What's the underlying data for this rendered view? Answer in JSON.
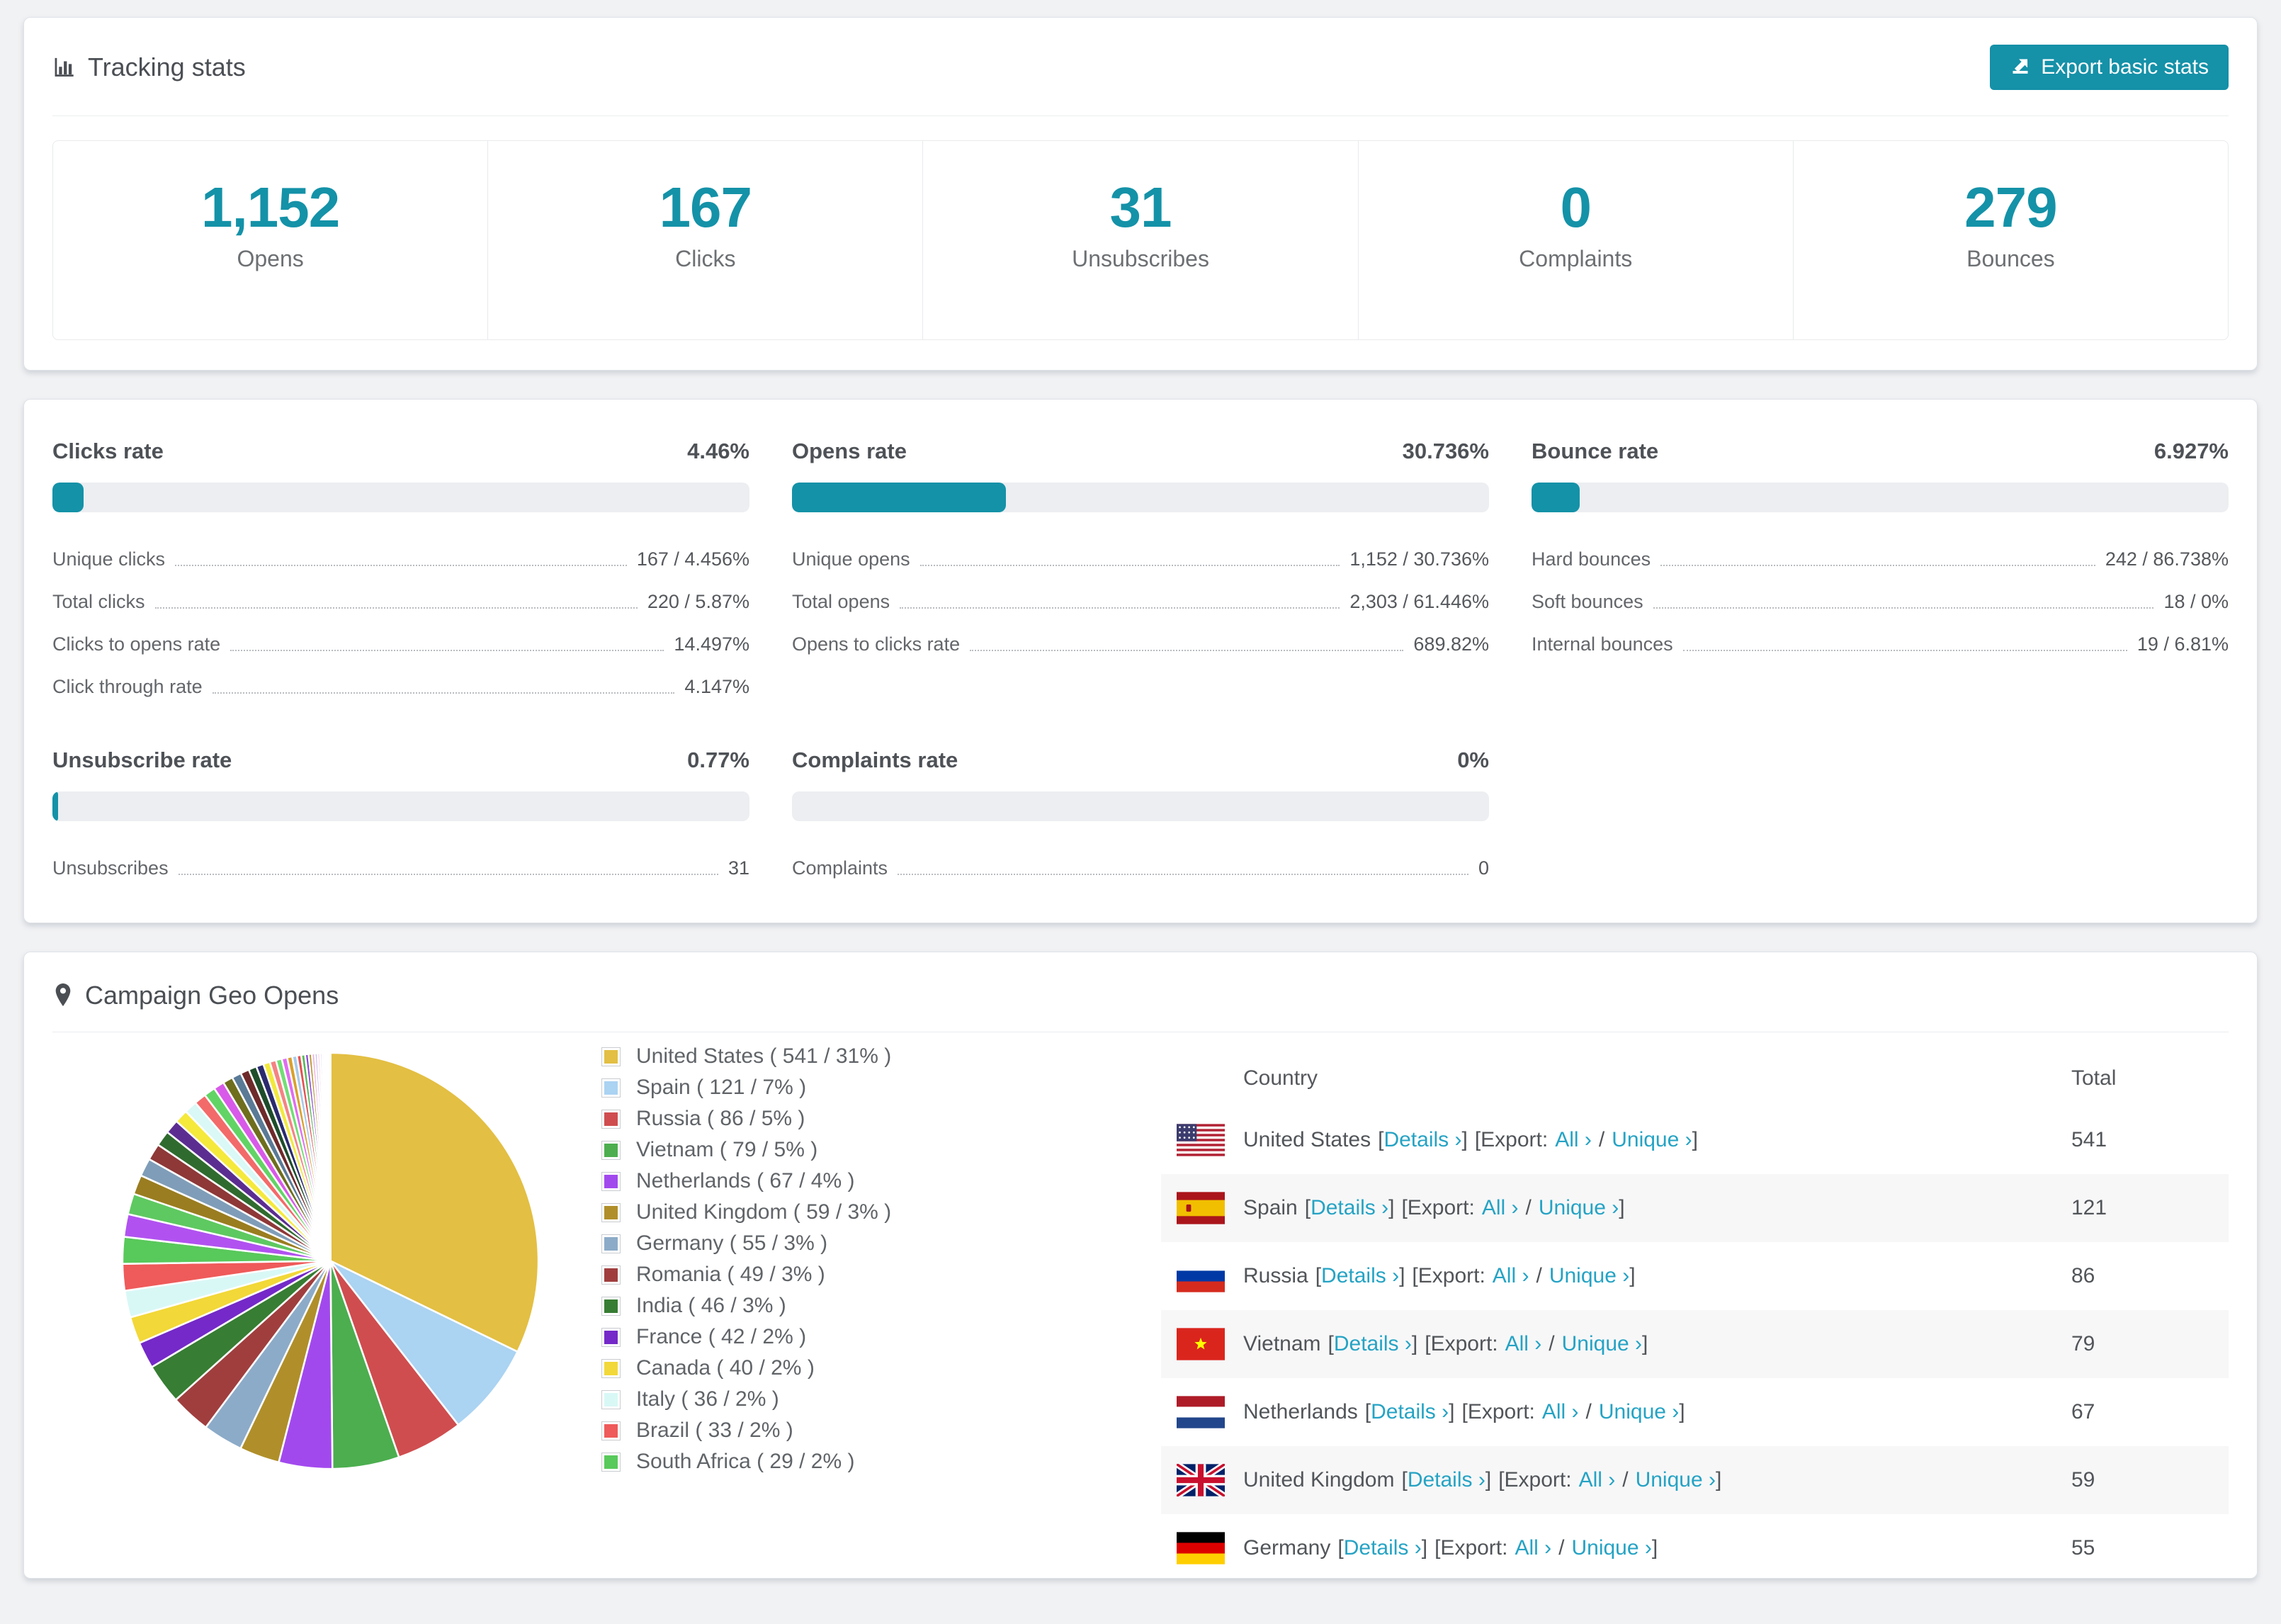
{
  "colors": {
    "accent": "#1492a8",
    "link": "#25a3c4",
    "bar_track": "#eceef1"
  },
  "tracking": {
    "title": "Tracking stats",
    "export_button": "Export basic stats",
    "stats": [
      {
        "value": "1,152",
        "label": "Opens"
      },
      {
        "value": "167",
        "label": "Clicks"
      },
      {
        "value": "31",
        "label": "Unsubscribes"
      },
      {
        "value": "0",
        "label": "Complaints"
      },
      {
        "value": "279",
        "label": "Bounces"
      }
    ]
  },
  "rates": {
    "panels": [
      {
        "title": "Clicks rate",
        "value": "4.46%",
        "pct": 4.46,
        "rows": [
          [
            "Unique clicks",
            "167 / 4.456%"
          ],
          [
            "Total clicks",
            "220 / 5.87%"
          ],
          [
            "Clicks to opens rate",
            "14.497%"
          ],
          [
            "Click through rate",
            "4.147%"
          ]
        ]
      },
      {
        "title": "Opens rate",
        "value": "30.736%",
        "pct": 30.736,
        "rows": [
          [
            "Unique opens",
            "1,152 / 30.736%"
          ],
          [
            "Total opens",
            "2,303 / 61.446%"
          ],
          [
            "Opens to clicks rate",
            "689.82%"
          ]
        ]
      },
      {
        "title": "Bounce rate",
        "value": "6.927%",
        "pct": 6.927,
        "rows": [
          [
            "Hard bounces",
            "242 / 86.738%"
          ],
          [
            "Soft bounces",
            "18 / 0%"
          ],
          [
            "Internal bounces",
            "19 / 6.81%"
          ]
        ]
      },
      {
        "title": "Unsubscribe rate",
        "value": "0.77%",
        "pct": 0.77,
        "rows": [
          [
            "Unsubscribes",
            "31"
          ]
        ]
      },
      {
        "title": "Complaints rate",
        "value": "0%",
        "pct": 0,
        "rows": [
          [
            "Complaints",
            "0"
          ]
        ]
      }
    ]
  },
  "geo": {
    "title": "Campaign Geo Opens",
    "legend": [
      {
        "label": "United States ( 541 / 31% )",
        "color": "#e3bf43"
      },
      {
        "label": "Spain ( 121 / 7% )",
        "color": "#abd3f2"
      },
      {
        "label": "Russia ( 86 / 5% )",
        "color": "#cf4d4f"
      },
      {
        "label": "Vietnam ( 79 / 5% )",
        "color": "#4cae4f"
      },
      {
        "label": "Netherlands ( 67 / 4% )",
        "color": "#a249ee"
      },
      {
        "label": "United Kingdom ( 59 / 3% )",
        "color": "#b08f2a"
      },
      {
        "label": "Germany ( 55 / 3% )",
        "color": "#8cabc8"
      },
      {
        "label": "Romania ( 49 / 3% )",
        "color": "#a03e3e"
      },
      {
        "label": "India ( 46 / 3% )",
        "color": "#377d33"
      },
      {
        "label": "France ( 42 / 2% )",
        "color": "#7429c8"
      },
      {
        "label": "Canada ( 40 / 2% )",
        "color": "#f2d838"
      },
      {
        "label": "Italy ( 36 / 2% )",
        "color": "#d8f8f6"
      },
      {
        "label": "Brazil ( 33 / 2% )",
        "color": "#ef5a5a"
      },
      {
        "label": "South Africa ( 29 / 2% )",
        "color": "#58c95b"
      }
    ],
    "table": {
      "country_header": "Country",
      "total_header": "Total",
      "syntax": {
        "open": "[",
        "close": "]",
        "export_open": "[Export:",
        "slash": "/"
      },
      "links": {
        "details": "Details ›",
        "all": "All ›",
        "unique": "Unique ›"
      },
      "rows": [
        {
          "flag": "us",
          "country": "United States",
          "total": "541"
        },
        {
          "flag": "es",
          "country": "Spain",
          "total": "121"
        },
        {
          "flag": "ru",
          "country": "Russia",
          "total": "86"
        },
        {
          "flag": "vn",
          "country": "Vietnam",
          "total": "79"
        },
        {
          "flag": "nl",
          "country": "Netherlands",
          "total": "67"
        },
        {
          "flag": "gb",
          "country": "United Kingdom",
          "total": "59"
        },
        {
          "flag": "de",
          "country": "Germany",
          "total": "55"
        }
      ]
    }
  },
  "chart_data": {
    "type": "pie",
    "title": "Campaign Geo Opens",
    "legend_position": "right",
    "start_angle_deg": -90,
    "direction": "clockwise",
    "slices": [
      {
        "name": "United States",
        "value": 541,
        "pct": 31,
        "color": "#e3bf43"
      },
      {
        "name": "Spain",
        "value": 121,
        "pct": 7,
        "color": "#abd3f2"
      },
      {
        "name": "Russia",
        "value": 86,
        "pct": 5,
        "color": "#cf4d4f"
      },
      {
        "name": "Vietnam",
        "value": 79,
        "pct": 5,
        "color": "#4cae4f"
      },
      {
        "name": "Netherlands",
        "value": 67,
        "pct": 4,
        "color": "#a249ee"
      },
      {
        "name": "United Kingdom",
        "value": 59,
        "pct": 3,
        "color": "#b08f2a"
      },
      {
        "name": "Germany",
        "value": 55,
        "pct": 3,
        "color": "#8cabc8"
      },
      {
        "name": "Romania",
        "value": 49,
        "pct": 3,
        "color": "#a03e3e"
      },
      {
        "name": "India",
        "value": 46,
        "pct": 3,
        "color": "#377d33"
      },
      {
        "name": "France",
        "value": 42,
        "pct": 2,
        "color": "#7429c8"
      },
      {
        "name": "Canada",
        "value": 40,
        "pct": 2,
        "color": "#f2d838"
      },
      {
        "name": "Italy",
        "value": 36,
        "pct": 2,
        "color": "#d8f8f6"
      },
      {
        "name": "Brazil",
        "value": 33,
        "pct": 2,
        "color": "#ef5a5a"
      },
      {
        "name": "South Africa",
        "value": 29,
        "pct": 2,
        "color": "#58c95b"
      }
    ],
    "other_slices": [
      {
        "pct": 1.7,
        "color": "#b152f0"
      },
      {
        "pct": 1.55,
        "color": "#5ec960"
      },
      {
        "pct": 1.45,
        "color": "#9a7d20"
      },
      {
        "pct": 1.35,
        "color": "#7f9db8"
      },
      {
        "pct": 1.25,
        "color": "#8e3838"
      },
      {
        "pct": 1.15,
        "color": "#2f6b2f"
      },
      {
        "pct": 1.05,
        "color": "#5b2d91"
      },
      {
        "pct": 1.0,
        "color": "#f5e93c"
      },
      {
        "pct": 0.95,
        "color": "#d9f8f6"
      },
      {
        "pct": 0.9,
        "color": "#f36a6a"
      },
      {
        "pct": 0.85,
        "color": "#62d465"
      },
      {
        "pct": 0.8,
        "color": "#d85ae8"
      },
      {
        "pct": 0.75,
        "color": "#6e6e1e"
      },
      {
        "pct": 0.7,
        "color": "#5a7a96"
      },
      {
        "pct": 0.65,
        "color": "#6e2a2a"
      },
      {
        "pct": 0.6,
        "color": "#1e4d2b"
      },
      {
        "pct": 0.55,
        "color": "#2a2a6e"
      },
      {
        "pct": 0.5,
        "color": "#f2e93c"
      },
      {
        "pct": 0.47,
        "color": "#f58383"
      },
      {
        "pct": 0.44,
        "color": "#72de74"
      },
      {
        "pct": 0.41,
        "color": "#e06cf0"
      },
      {
        "pct": 0.38,
        "color": "#d9a02c"
      },
      {
        "pct": 0.35,
        "color": "#a7c9e8"
      },
      {
        "pct": 0.32,
        "color": "#e45052"
      },
      {
        "pct": 0.29,
        "color": "#57b85a"
      },
      {
        "pct": 0.26,
        "color": "#8a46d8"
      },
      {
        "pct": 0.24,
        "color": "#b8922a"
      },
      {
        "pct": 0.22,
        "color": "#f0a8d8"
      },
      {
        "pct": 0.2,
        "color": "#c8b8f0"
      },
      {
        "pct": 0.18,
        "color": "#f5c6d8"
      },
      {
        "pct": 0.16,
        "color": "#d8c8f8"
      },
      {
        "pct": 0.14,
        "color": "#b8922a"
      },
      {
        "pct": 0.12,
        "color": "#e890c8"
      },
      {
        "pct": 0.1,
        "color": "#c0a8e8"
      },
      {
        "pct": 0.08,
        "color": "#f0c8e0"
      },
      {
        "pct": 0.07,
        "color": "#d0b8f0"
      },
      {
        "pct": 0.06,
        "color": "#e8d0f0"
      },
      {
        "pct": 0.05,
        "color": "#f8e0e8"
      }
    ]
  }
}
